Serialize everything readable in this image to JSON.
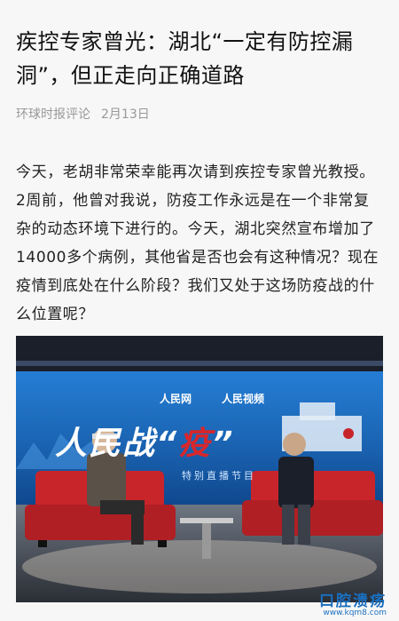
{
  "article": {
    "title": "疾控专家曾光：湖北“一定有防控漏洞”，但正走向正确道路",
    "source": "环球时报评论",
    "date": "2月13日",
    "paragraph": "今天，老胡非常荣幸能再次请到疾控专家曾光教授。2周前，他曾对我说，防疫工作永远是在一个非常复杂的动态环境下进行的。今天，湖北突然宣布增加了14000多个病例，其他省是否也会有这种情况？现在疫情到底处在什么阶段？我们又处于这场防疫战的什么位置呢？"
  },
  "photo": {
    "screen_title_a": "人民战“",
    "screen_title_b": "疫",
    "screen_title_c": "”",
    "screen_sub": "特别直播节目",
    "logo_a": "人民网",
    "logo_b": "人民视频"
  },
  "watermark": {
    "line1": "口腔溃疡",
    "line2": "www.kqm8.com"
  },
  "colors": {
    "background": "#f7f7f7",
    "meta_text": "#999999",
    "screen_blue": "#1c6fc0",
    "sofa_red": "#c8252b",
    "highlight_red": "#d9262b",
    "watermark_blue": "#1b6fbf"
  }
}
